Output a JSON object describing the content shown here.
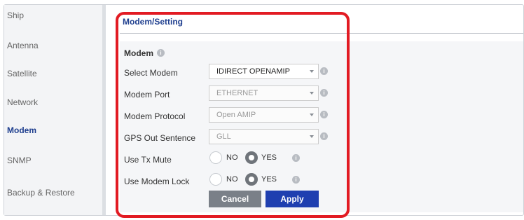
{
  "sidebar": {
    "items": [
      {
        "label": "Ship",
        "active": false
      },
      {
        "label": "Antenna",
        "active": false
      },
      {
        "label": "Satellite",
        "active": false
      },
      {
        "label": "Network",
        "active": false
      },
      {
        "label": "Modem",
        "active": true
      },
      {
        "label": "SNMP",
        "active": false
      },
      {
        "label": "Backup & Restore",
        "active": false
      }
    ]
  },
  "page": {
    "title": "Modem/Setting",
    "section_title": "Modem"
  },
  "form": {
    "select_modem_label": "Select Modem",
    "select_modem_value": "IDIRECT OPENAMIP",
    "modem_port_label": "Modem Port",
    "modem_port_value": "ETHERNET",
    "modem_protocol_label": "Modem Protocol",
    "modem_protocol_value": "Open AMIP",
    "gps_out_label": "GPS Out Sentence",
    "gps_out_value": "GLL",
    "tx_mute_label": "Use Tx Mute",
    "tx_mute_no": "NO",
    "tx_mute_yes": "YES",
    "tx_mute_selected": "YES",
    "modem_lock_label": "Use Modem Lock",
    "modem_lock_no": "NO",
    "modem_lock_yes": "YES",
    "modem_lock_selected": "YES"
  },
  "buttons": {
    "cancel": "Cancel",
    "apply": "Apply"
  },
  "colors": {
    "accent": "#1f3fb0",
    "highlight": "#e21b23"
  },
  "icons": {
    "info": "info-icon",
    "caret": "caret-down-icon"
  }
}
